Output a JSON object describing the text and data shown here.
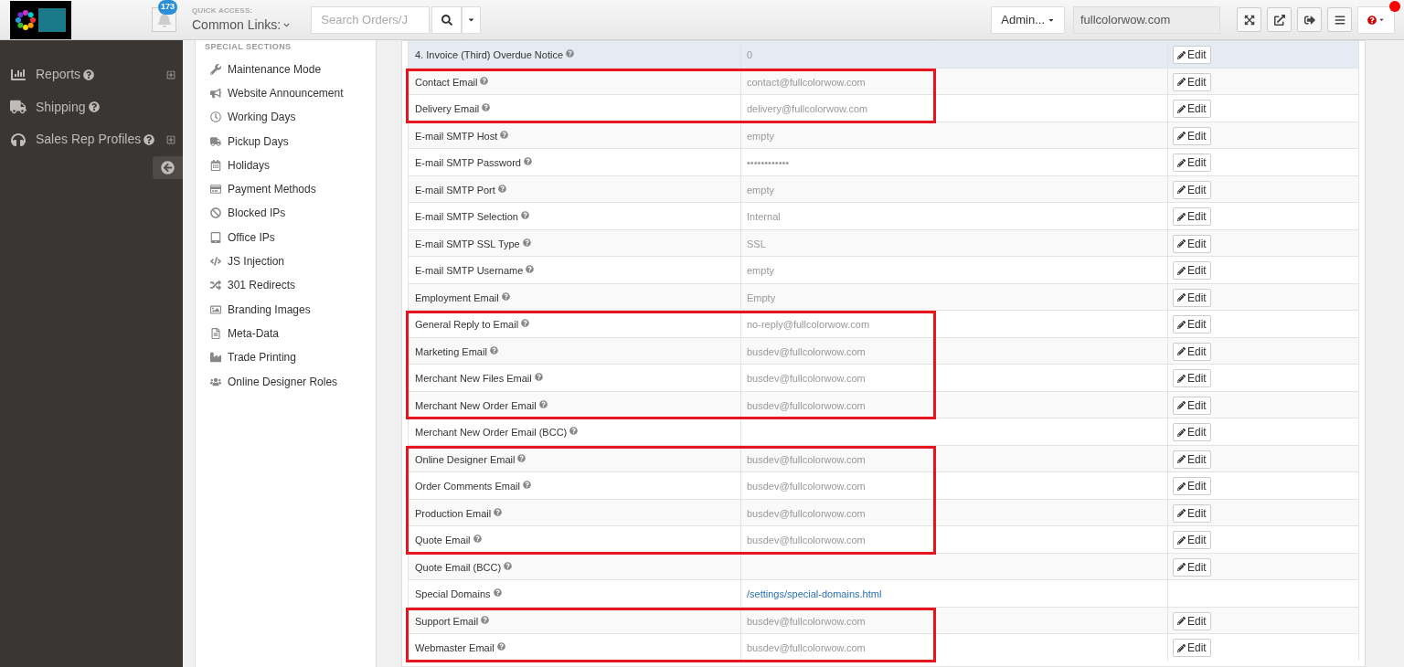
{
  "header": {
    "notifications": "173",
    "quick_access_label": "QUICK ACCESS:",
    "quick_links": "Common Links:",
    "search": {
      "placeholder": "Search Orders/J"
    },
    "user_menu": "Admin...",
    "domain": "fullcolorwow.com",
    "alert_dot": true
  },
  "sidebar": {
    "items": [
      {
        "label": "Reports",
        "expandable": true
      },
      {
        "label": "Shipping",
        "expandable": false
      },
      {
        "label": "Sales Rep Profiles",
        "expandable": true
      }
    ]
  },
  "section_menu": {
    "heading": "SPECIAL SECTIONS",
    "items": [
      "Maintenance Mode",
      "Website Announcement",
      "Working Days",
      "Pickup Days",
      "Holidays",
      "Payment Methods",
      "Blocked IPs",
      "Office IPs",
      "JS Injection",
      "301 Redirects",
      "Branding Images",
      "Meta-Data",
      "Trade Printing",
      "Online Designer Roles"
    ]
  },
  "rows": [
    {
      "label": "4. Invoice (Third) Overdue Notice",
      "value": "0",
      "kind": "text",
      "edit": "Edit",
      "hovered": true,
      "highlighted": false
    },
    {
      "label": "Contact Email",
      "value": "contact@fullcolorwow.com",
      "kind": "text",
      "edit": "Edit",
      "hovered": false,
      "highlighted": true
    },
    {
      "label": "Delivery Email",
      "value": "delivery@fullcolorwow.com",
      "kind": "text",
      "edit": "Edit",
      "hovered": false,
      "highlighted": true
    },
    {
      "label": "E-mail SMTP Host",
      "value": "empty",
      "kind": "text",
      "edit": "Edit",
      "hovered": false,
      "highlighted": false
    },
    {
      "label": "E-mail SMTP Password",
      "value": "••••••••••••",
      "kind": "text",
      "edit": "Edit",
      "hovered": false,
      "highlighted": false
    },
    {
      "label": "E-mail SMTP Port",
      "value": "empty",
      "kind": "text",
      "edit": "Edit",
      "hovered": false,
      "highlighted": false
    },
    {
      "label": "E-mail SMTP Selection",
      "value": "Internal",
      "kind": "text",
      "edit": "Edit",
      "hovered": false,
      "highlighted": false
    },
    {
      "label": "E-mail SMTP SSL Type",
      "value": "SSL",
      "kind": "text",
      "edit": "Edit",
      "hovered": false,
      "highlighted": false
    },
    {
      "label": "E-mail SMTP Username",
      "value": "empty",
      "kind": "text",
      "edit": "Edit",
      "hovered": false,
      "highlighted": false
    },
    {
      "label": "Employment Email",
      "value": "Empty",
      "kind": "text",
      "edit": "Edit",
      "hovered": false,
      "highlighted": false
    },
    {
      "label": "General Reply to Email",
      "value": "no-reply@fullcolorwow.com",
      "kind": "text",
      "edit": "Edit",
      "hovered": false,
      "highlighted": true
    },
    {
      "label": "Marketing Email",
      "value": "busdev@fullcolorwow.com",
      "kind": "text",
      "edit": "Edit",
      "hovered": false,
      "highlighted": true
    },
    {
      "label": "Merchant New Files Email",
      "value": "busdev@fullcolorwow.com",
      "kind": "text",
      "edit": "Edit",
      "hovered": false,
      "highlighted": true
    },
    {
      "label": "Merchant New Order Email",
      "value": "busdev@fullcolorwow.com",
      "kind": "text",
      "edit": "Edit",
      "hovered": false,
      "highlighted": true
    },
    {
      "label": "Merchant New Order Email (BCC)",
      "edit": "Edit",
      "hovered": false,
      "highlighted": false
    },
    {
      "label": "Online Designer Email",
      "value": "busdev@fullcolorwow.com",
      "kind": "text",
      "edit": "Edit",
      "hovered": false,
      "highlighted": true
    },
    {
      "label": "Order Comments Email",
      "value": "busdev@fullcolorwow.com",
      "kind": "text",
      "edit": "Edit",
      "hovered": false,
      "highlighted": true
    },
    {
      "label": "Production Email",
      "value": "busdev@fullcolorwow.com",
      "kind": "text",
      "edit": "Edit",
      "hovered": false,
      "highlighted": true
    },
    {
      "label": "Quote Email",
      "value": "busdev@fullcolorwow.com",
      "kind": "text",
      "edit": "Edit",
      "hovered": false,
      "highlighted": true
    },
    {
      "label": "Quote Email (BCC)",
      "edit": "Edit",
      "hovered": false,
      "highlighted": false
    },
    {
      "label": "Special Domains",
      "value": "/settings/special-domains.html",
      "kind": "link",
      "hovered": false,
      "highlighted": false
    },
    {
      "label": "Support Email",
      "value": "busdev@fullcolorwow.com",
      "kind": "text",
      "edit": "Edit",
      "hovered": false,
      "highlighted": true
    },
    {
      "label": "Webmaster Email",
      "value": "busdev@fullcolorwow.com",
      "kind": "text",
      "edit": "Edit",
      "hovered": false,
      "highlighted": true
    }
  ]
}
